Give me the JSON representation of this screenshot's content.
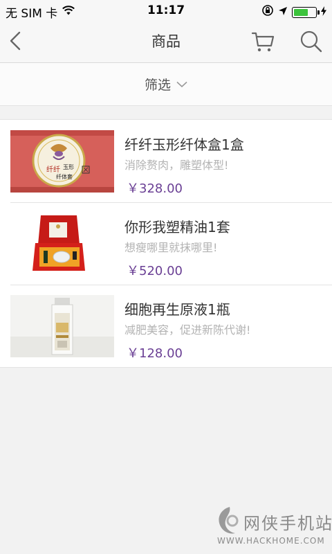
{
  "status_bar": {
    "carrier": "无 SIM 卡",
    "time": "11:17",
    "battery_level": 0.7,
    "battery_color": "#3cc33c",
    "icons": [
      "wifi-icon",
      "orientation-lock-icon",
      "location-arrow-icon",
      "battery-icon",
      "charging-bolt-icon"
    ]
  },
  "navbar": {
    "title": "商品",
    "icons": [
      "back-chevron-icon",
      "cart-icon",
      "search-icon"
    ]
  },
  "filter": {
    "label": "筛选"
  },
  "products": [
    {
      "title": "纤纤玉形纤体盒1盒",
      "subtitle": "消除赘肉，雕塑体型!",
      "price": "￥328.00",
      "image_icon": "slimming-box-product-image"
    },
    {
      "title": "你形我塑精油1套",
      "subtitle": "想瘦哪里就抹哪里!",
      "price": "￥520.00",
      "image_icon": "essential-oil-set-product-image"
    },
    {
      "title": "细胞再生原液1瓶",
      "subtitle": "减肥美容，促进新陈代谢!",
      "price": "￥128.00",
      "image_icon": "serum-bottle-product-image"
    }
  ],
  "accent_color": "#6a3f94",
  "watermark": {
    "text": "网侠手机站",
    "url": "WWW.HACKHOME.COM"
  }
}
